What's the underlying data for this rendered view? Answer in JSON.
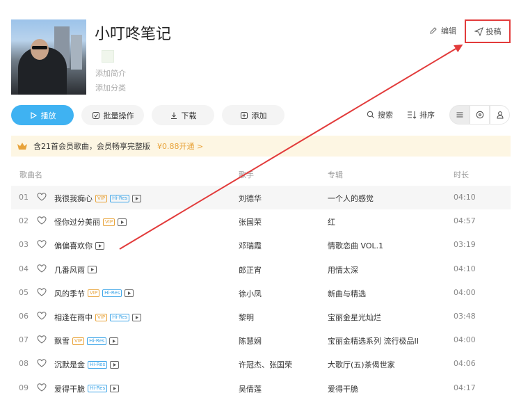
{
  "playlist": {
    "title": "小叮咚笔记",
    "add_intro": "添加简介",
    "add_category": "添加分类"
  },
  "header_actions": {
    "edit_label": "编辑",
    "submit_label": "投稿"
  },
  "toolbar": {
    "play_label": "播放",
    "batch_label": "批量操作",
    "download_label": "下载",
    "add_label": "添加",
    "search_label": "搜索",
    "sort_label": "排序"
  },
  "vip_banner": {
    "text": "含21首会员歌曲，会员畅享完整版",
    "price_text": "¥0.88开通 >"
  },
  "columns": {
    "song": "歌曲名",
    "singer": "歌手",
    "album": "专辑",
    "duration": "时长"
  },
  "songs": [
    {
      "num": "01",
      "title": "我很我痴心",
      "vip": true,
      "hires": true,
      "mv": true,
      "singer": "刘德华",
      "album": "一个人的感觉",
      "duration": "04:10"
    },
    {
      "num": "02",
      "title": "怪你过分美丽",
      "vip": true,
      "hires": false,
      "mv": true,
      "singer": "张国荣",
      "album": "红",
      "duration": "04:57"
    },
    {
      "num": "03",
      "title": "偏偏喜欢你",
      "vip": false,
      "hires": false,
      "mv": true,
      "singer": "邓瑞霞",
      "album": "情歌恋曲 VOL.1",
      "duration": "03:19"
    },
    {
      "num": "04",
      "title": "几番风雨",
      "vip": false,
      "hires": false,
      "mv": true,
      "singer": "郎正宵",
      "album": "用情太深",
      "duration": "04:10"
    },
    {
      "num": "05",
      "title": "风的季节",
      "vip": true,
      "hires": true,
      "mv": true,
      "singer": "徐小凤",
      "album": "新曲与精选",
      "duration": "04:00"
    },
    {
      "num": "06",
      "title": "相逢在雨中",
      "vip": true,
      "hires": true,
      "mv": true,
      "singer": "黎明",
      "album": "宝丽金星光灿烂",
      "duration": "03:48"
    },
    {
      "num": "07",
      "title": "飘雪",
      "vip": true,
      "hires": true,
      "mv": true,
      "singer": "陈慧娴",
      "album": "宝丽金精选系列 流行极品II",
      "duration": "04:00"
    },
    {
      "num": "08",
      "title": "沉默是金",
      "vip": false,
      "hires": true,
      "mv": true,
      "singer": "许冠杰、张国荣",
      "album": "大歌厅(五)茶偈世家",
      "duration": "04:06"
    },
    {
      "num": "09",
      "title": "爱得干脆",
      "vip": false,
      "hires": true,
      "mv": true,
      "singer": "吴倩莲",
      "album": "爱得干脆",
      "duration": "04:17"
    }
  ],
  "colors": {
    "accent": "#3fb2f2",
    "vip": "#e8a33a",
    "hires": "#3fa6e8",
    "annotation": "#e23b3b"
  }
}
